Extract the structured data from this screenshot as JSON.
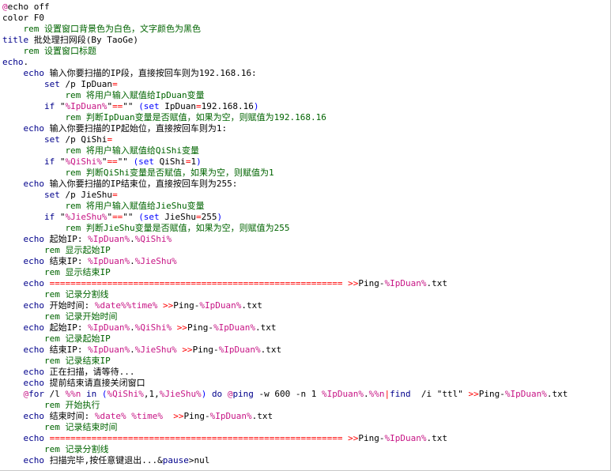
{
  "editor": {
    "colors": {
      "kw": "#00008b",
      "text": "#000000",
      "var": "#c71585",
      "op": "#ff0000",
      "comment": "#006400",
      "paren": "#0000ff",
      "string": "#a0a0a0",
      "label": "#800080"
    },
    "lines": [
      {
        "indent": 0,
        "segs": [
          {
            "t": "@",
            "c": "var"
          },
          {
            "t": "echo off",
            "c": "text"
          }
        ]
      },
      {
        "indent": 0,
        "segs": [
          {
            "t": "color F0",
            "c": "text"
          }
        ]
      },
      {
        "indent": 4,
        "segs": [
          {
            "t": "rem 设置窗口背景色为白色，文字颜色为黑色",
            "c": "comment"
          }
        ]
      },
      {
        "indent": 0,
        "segs": [
          {
            "t": "title",
            "c": "kw"
          },
          {
            "t": " 批处理扫网段(By TaoGe)",
            "c": "text"
          }
        ]
      },
      {
        "indent": 4,
        "segs": [
          {
            "t": "rem 设置窗口标题",
            "c": "comment"
          }
        ]
      },
      {
        "indent": 0,
        "segs": [
          {
            "t": "echo",
            "c": "kw"
          },
          {
            "t": ".",
            "c": "text"
          }
        ]
      },
      {
        "indent": 4,
        "segs": [
          {
            "t": "echo",
            "c": "kw"
          },
          {
            "t": " 输入你要扫描的IP段，直接按回车则为192.168.16:",
            "c": "text"
          }
        ]
      },
      {
        "indent": 8,
        "segs": [
          {
            "t": "set",
            "c": "kw"
          },
          {
            "t": " /p IpDuan",
            "c": "text"
          },
          {
            "t": "=",
            "c": "op"
          }
        ]
      },
      {
        "indent": 12,
        "segs": [
          {
            "t": "rem 将用户输入赋值给IpDuan变量",
            "c": "comment"
          }
        ]
      },
      {
        "indent": 8,
        "segs": [
          {
            "t": "if",
            "c": "kw"
          },
          {
            "t": " \"",
            "c": "text"
          },
          {
            "t": "%IpDuan%",
            "c": "var"
          },
          {
            "t": "\"",
            "c": "text"
          },
          {
            "t": "==",
            "c": "op"
          },
          {
            "t": "\"\" ",
            "c": "text"
          },
          {
            "t": "(set",
            "c": "paren"
          },
          {
            "t": " IpDuan",
            "c": "text"
          },
          {
            "t": "=",
            "c": "op"
          },
          {
            "t": "192.168.16",
            "c": "text"
          },
          {
            "t": ")",
            "c": "paren"
          }
        ]
      },
      {
        "indent": 12,
        "segs": [
          {
            "t": "rem 判断IpDuan变量是否赋值，如果为空，则赋值为192.168.16",
            "c": "comment"
          }
        ]
      },
      {
        "indent": 4,
        "segs": [
          {
            "t": "echo",
            "c": "kw"
          },
          {
            "t": " 输入你要扫描的IP起始位，直接按回车则为1:",
            "c": "text"
          }
        ]
      },
      {
        "indent": 8,
        "segs": [
          {
            "t": "set",
            "c": "kw"
          },
          {
            "t": " /p QiShi",
            "c": "text"
          },
          {
            "t": "=",
            "c": "op"
          }
        ]
      },
      {
        "indent": 12,
        "segs": [
          {
            "t": "rem 将用户输入赋值给QiShi变量",
            "c": "comment"
          }
        ]
      },
      {
        "indent": 8,
        "segs": [
          {
            "t": "if",
            "c": "kw"
          },
          {
            "t": " \"",
            "c": "text"
          },
          {
            "t": "%QiShi%",
            "c": "var"
          },
          {
            "t": "\"",
            "c": "text"
          },
          {
            "t": "==",
            "c": "op"
          },
          {
            "t": "\"\" ",
            "c": "text"
          },
          {
            "t": "(set",
            "c": "paren"
          },
          {
            "t": " QiShi",
            "c": "text"
          },
          {
            "t": "=",
            "c": "op"
          },
          {
            "t": "1",
            "c": "text"
          },
          {
            "t": ")",
            "c": "paren"
          }
        ]
      },
      {
        "indent": 12,
        "segs": [
          {
            "t": "rem 判断QiShi变量是否赋值，如果为空，则赋值为1",
            "c": "comment"
          }
        ]
      },
      {
        "indent": 4,
        "segs": [
          {
            "t": "echo",
            "c": "kw"
          },
          {
            "t": " 输入你要扫描的IP结束位，直接按回车则为255:",
            "c": "text"
          }
        ]
      },
      {
        "indent": 8,
        "segs": [
          {
            "t": "set",
            "c": "kw"
          },
          {
            "t": " /p JieShu",
            "c": "text"
          },
          {
            "t": "=",
            "c": "op"
          }
        ]
      },
      {
        "indent": 12,
        "segs": [
          {
            "t": "rem 将用户输入赋值给JieShu变量",
            "c": "comment"
          }
        ]
      },
      {
        "indent": 8,
        "segs": [
          {
            "t": "if",
            "c": "kw"
          },
          {
            "t": " \"",
            "c": "text"
          },
          {
            "t": "%JieShu%",
            "c": "var"
          },
          {
            "t": "\"",
            "c": "text"
          },
          {
            "t": "==",
            "c": "op"
          },
          {
            "t": "\"\" ",
            "c": "text"
          },
          {
            "t": "(set",
            "c": "paren"
          },
          {
            "t": " JieShu",
            "c": "text"
          },
          {
            "t": "=",
            "c": "op"
          },
          {
            "t": "255",
            "c": "text"
          },
          {
            "t": ")",
            "c": "paren"
          }
        ]
      },
      {
        "indent": 12,
        "segs": [
          {
            "t": "rem 判断JieShu变量是否赋值，如果为空，则赋值为255",
            "c": "comment"
          }
        ]
      },
      {
        "indent": 4,
        "segs": [
          {
            "t": "echo",
            "c": "kw"
          },
          {
            "t": " 起始IP: ",
            "c": "text"
          },
          {
            "t": "%IpDuan%",
            "c": "var"
          },
          {
            "t": ".",
            "c": "text"
          },
          {
            "t": "%QiShi%",
            "c": "var"
          }
        ]
      },
      {
        "indent": 8,
        "segs": [
          {
            "t": "rem 显示起始IP",
            "c": "comment"
          }
        ]
      },
      {
        "indent": 4,
        "segs": [
          {
            "t": "echo",
            "c": "kw"
          },
          {
            "t": " 结束IP: ",
            "c": "text"
          },
          {
            "t": "%IpDuan%",
            "c": "var"
          },
          {
            "t": ".",
            "c": "text"
          },
          {
            "t": "%JieShu%",
            "c": "var"
          }
        ]
      },
      {
        "indent": 8,
        "segs": [
          {
            "t": "rem 显示结束IP",
            "c": "comment"
          }
        ]
      },
      {
        "indent": 4,
        "segs": [
          {
            "t": "echo",
            "c": "kw"
          },
          {
            "t": " ",
            "c": "text"
          },
          {
            "t": "========================================================",
            "c": "op"
          },
          {
            "t": " ",
            "c": "text"
          },
          {
            "t": ">>",
            "c": "op"
          },
          {
            "t": "Ping-",
            "c": "text"
          },
          {
            "t": "%IpDuan%",
            "c": "var"
          },
          {
            "t": ".txt",
            "c": "text"
          }
        ]
      },
      {
        "indent": 8,
        "segs": [
          {
            "t": "rem 记录分割线",
            "c": "comment"
          }
        ]
      },
      {
        "indent": 4,
        "segs": [
          {
            "t": "echo",
            "c": "kw"
          },
          {
            "t": " 开始时间: ",
            "c": "text"
          },
          {
            "t": "%date%",
            "c": "var"
          },
          {
            "t": "%time%",
            "c": "var"
          },
          {
            "t": " ",
            "c": "text"
          },
          {
            "t": ">>",
            "c": "op"
          },
          {
            "t": "Ping-",
            "c": "text"
          },
          {
            "t": "%IpDuan%",
            "c": "var"
          },
          {
            "t": ".txt",
            "c": "text"
          }
        ]
      },
      {
        "indent": 8,
        "segs": [
          {
            "t": "rem 记录开始时间",
            "c": "comment"
          }
        ]
      },
      {
        "indent": 4,
        "segs": [
          {
            "t": "echo",
            "c": "kw"
          },
          {
            "t": " 起始IP: ",
            "c": "text"
          },
          {
            "t": "%IpDuan%",
            "c": "var"
          },
          {
            "t": ".",
            "c": "text"
          },
          {
            "t": "%QiShi%",
            "c": "var"
          },
          {
            "t": " ",
            "c": "text"
          },
          {
            "t": ">>",
            "c": "op"
          },
          {
            "t": "Ping-",
            "c": "text"
          },
          {
            "t": "%IpDuan%",
            "c": "var"
          },
          {
            "t": ".txt",
            "c": "text"
          }
        ]
      },
      {
        "indent": 8,
        "segs": [
          {
            "t": "rem 记录起始IP",
            "c": "comment"
          }
        ]
      },
      {
        "indent": 4,
        "segs": [
          {
            "t": "echo",
            "c": "kw"
          },
          {
            "t": " 结束IP: ",
            "c": "text"
          },
          {
            "t": "%IpDuan%",
            "c": "var"
          },
          {
            "t": ".",
            "c": "text"
          },
          {
            "t": "%JieShu%",
            "c": "var"
          },
          {
            "t": " ",
            "c": "text"
          },
          {
            "t": ">>",
            "c": "op"
          },
          {
            "t": "Ping-",
            "c": "text"
          },
          {
            "t": "%IpDuan%",
            "c": "var"
          },
          {
            "t": ".txt",
            "c": "text"
          }
        ]
      },
      {
        "indent": 8,
        "segs": [
          {
            "t": "rem 记录结束IP",
            "c": "comment"
          }
        ]
      },
      {
        "indent": 4,
        "segs": [
          {
            "t": "echo",
            "c": "kw"
          },
          {
            "t": " 正在扫描，请等待...",
            "c": "text"
          }
        ]
      },
      {
        "indent": 4,
        "segs": [
          {
            "t": "echo",
            "c": "kw"
          },
          {
            "t": " 提前结束请直接关闭窗口",
            "c": "text"
          }
        ]
      },
      {
        "indent": 4,
        "segs": [
          {
            "t": "@",
            "c": "var"
          },
          {
            "t": "for",
            "c": "kw"
          },
          {
            "t": " /l ",
            "c": "text"
          },
          {
            "t": "%%n",
            "c": "var"
          },
          {
            "t": " ",
            "c": "text"
          },
          {
            "t": "in",
            "c": "kw"
          },
          {
            "t": " ",
            "c": "text"
          },
          {
            "t": "(",
            "c": "paren"
          },
          {
            "t": "%QiShi%",
            "c": "var"
          },
          {
            "t": ",1,",
            "c": "text"
          },
          {
            "t": "%JieShu%",
            "c": "var"
          },
          {
            "t": ")",
            "c": "paren"
          },
          {
            "t": " ",
            "c": "text"
          },
          {
            "t": "do",
            "c": "kw"
          },
          {
            "t": " ",
            "c": "text"
          },
          {
            "t": "@",
            "c": "var"
          },
          {
            "t": "ping",
            "c": "kw"
          },
          {
            "t": " -w 600 -n 1 ",
            "c": "text"
          },
          {
            "t": "%IpDuan%",
            "c": "var"
          },
          {
            "t": ".",
            "c": "text"
          },
          {
            "t": "%%n",
            "c": "var"
          },
          {
            "t": "|",
            "c": "op"
          },
          {
            "t": "find",
            "c": "kw"
          },
          {
            "t": "  /i \"ttl\" ",
            "c": "text"
          },
          {
            "t": ">>",
            "c": "op"
          },
          {
            "t": "Ping-",
            "c": "text"
          },
          {
            "t": "%IpDuan%",
            "c": "var"
          },
          {
            "t": ".txt",
            "c": "text"
          }
        ]
      },
      {
        "indent": 8,
        "segs": [
          {
            "t": "rem 开始执行",
            "c": "comment"
          }
        ]
      },
      {
        "indent": 4,
        "segs": [
          {
            "t": "echo",
            "c": "kw"
          },
          {
            "t": " 结束时间: ",
            "c": "text"
          },
          {
            "t": "%date%",
            "c": "var"
          },
          {
            "t": " ",
            "c": "text"
          },
          {
            "t": "%time%",
            "c": "var"
          },
          {
            "t": "  ",
            "c": "text"
          },
          {
            "t": ">>",
            "c": "op"
          },
          {
            "t": "Ping-",
            "c": "text"
          },
          {
            "t": "%IpDuan%",
            "c": "var"
          },
          {
            "t": ".txt",
            "c": "text"
          }
        ]
      },
      {
        "indent": 8,
        "segs": [
          {
            "t": "rem 记录结束时间",
            "c": "comment"
          }
        ]
      },
      {
        "indent": 4,
        "segs": [
          {
            "t": "echo",
            "c": "kw"
          },
          {
            "t": " ",
            "c": "text"
          },
          {
            "t": "========================================================",
            "c": "op"
          },
          {
            "t": " ",
            "c": "text"
          },
          {
            "t": ">>",
            "c": "op"
          },
          {
            "t": "Ping-",
            "c": "text"
          },
          {
            "t": "%IpDuan%",
            "c": "var"
          },
          {
            "t": ".txt",
            "c": "text"
          }
        ]
      },
      {
        "indent": 8,
        "segs": [
          {
            "t": "rem 记录分割线",
            "c": "comment"
          }
        ]
      },
      {
        "indent": 4,
        "segs": [
          {
            "t": "echo",
            "c": "kw"
          },
          {
            "t": " 扫描完毕,按任意键退出...&",
            "c": "text"
          },
          {
            "t": "pause",
            "c": "kw"
          },
          {
            "t": ">nul",
            "c": "text"
          }
        ]
      }
    ]
  }
}
